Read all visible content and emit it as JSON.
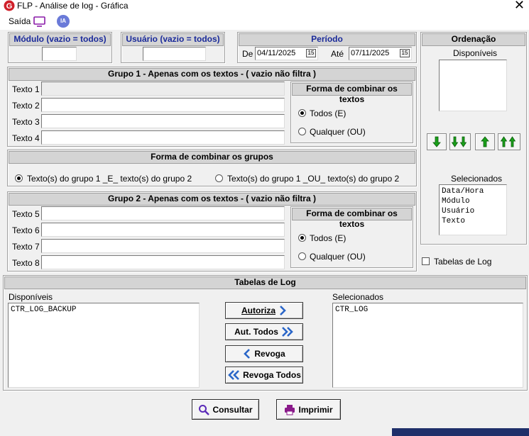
{
  "window": {
    "title": "FLP - Análise de log - Gráfica"
  },
  "menu": {
    "saida_label": "Saída",
    "ia_label": "IA"
  },
  "filters": {
    "modulo_header": "Módulo (vazio = todos)",
    "usuario_header": "Usuário (vazio = todos)",
    "periodo_header": "Período",
    "de_label": "De",
    "de_value": "04/11/2025",
    "ate_label": "Até",
    "ate_value": "07/11/2025",
    "cal_glyph": "15"
  },
  "grupo1": {
    "header": "Grupo 1 - Apenas com os textos - ( vazio não filtra )",
    "labels": [
      "Texto 1",
      "Texto 2",
      "Texto 3",
      "Texto 4"
    ],
    "combine_header": "Forma de combinar os textos",
    "opt_todos": "Todos (E)",
    "opt_qualquer": "Qualquer (OU)"
  },
  "grupos": {
    "header": "Forma de combinar os grupos",
    "opt_e": "Texto(s) do grupo 1 _E_ texto(s) do grupo 2",
    "opt_ou": "Texto(s) do grupo 1 _OU_ texto(s) do grupo 2"
  },
  "grupo2": {
    "header": "Grupo 2 - Apenas com os textos - ( vazio não filtra )",
    "labels": [
      "Texto 5",
      "Texto 6",
      "Texto 7",
      "Texto 8"
    ],
    "combine_header": "Forma de combinar os textos",
    "opt_todos": "Todos (E)",
    "opt_qualquer": "Qualquer (OU)"
  },
  "ordenacao": {
    "header": "Ordenação",
    "disponiveis_label": "Disponíveis",
    "selecionados_label": "Selecionados",
    "selecionados": [
      "Data/Hora",
      "Módulo",
      "Usuário",
      "Texto"
    ]
  },
  "tabelas_check_label": "Tabelas de Log",
  "tabelas": {
    "header": "Tabelas de Log",
    "disponiveis_label": "Disponíveis",
    "selecionados_label": "Selecionados",
    "disponiveis": [
      "CTR_LOG_BACKUP"
    ],
    "selecionados": [
      "CTR_LOG"
    ],
    "autoriza": "Autoriza",
    "aut_todos": "Aut. Todos",
    "revoga": "Revoga",
    "revoga_todos": "Revoga Todos"
  },
  "actions": {
    "consultar": "Consultar",
    "imprimir": "Imprimir"
  },
  "colors": {
    "header_blue": "#1a2a9a",
    "arrow_green": "#1aa01a",
    "icon_blue": "#2a66c8",
    "print_purple": "#8a1a8a"
  }
}
